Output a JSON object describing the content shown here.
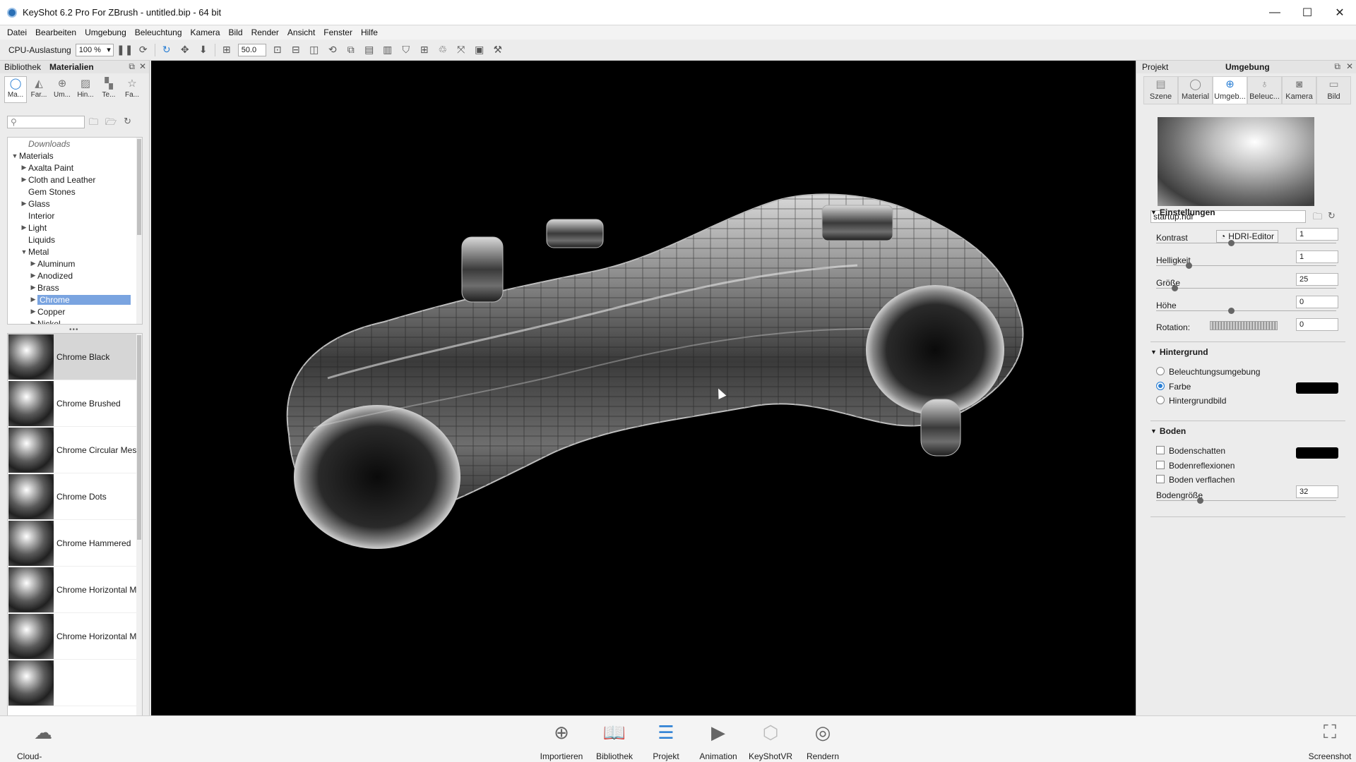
{
  "window": {
    "title": "KeyShot 6.2 Pro For ZBrush - untitled.bip  - 64 bit",
    "minimize": "—",
    "maximize": "☐",
    "close": "✕"
  },
  "menu": [
    "Datei",
    "Bearbeiten",
    "Umgebung",
    "Beleuchtung",
    "Kamera",
    "Bild",
    "Render",
    "Ansicht",
    "Fenster",
    "Hilfe"
  ],
  "toolbar": {
    "cpu_label": "CPU-Auslastung",
    "cpu_value": "100 %",
    "focal_value": "50.0"
  },
  "left_panel": {
    "tabs_header": [
      "Bibliothek",
      "Materialien"
    ],
    "tabs": [
      "Ma...",
      "Far...",
      "Um...",
      "Hin...",
      "Te...",
      "Fa..."
    ],
    "search_placeholder": "",
    "tree": [
      {
        "label": "Downloads",
        "level": 1,
        "arrow": "",
        "italic": true
      },
      {
        "label": "Materials",
        "level": 0,
        "arrow": "▼"
      },
      {
        "label": "Axalta Paint",
        "level": 1,
        "arrow": "▶"
      },
      {
        "label": "Cloth and Leather",
        "level": 1,
        "arrow": "▶"
      },
      {
        "label": "Gem Stones",
        "level": 1,
        "arrow": ""
      },
      {
        "label": "Glass",
        "level": 1,
        "arrow": "▶"
      },
      {
        "label": "Interior",
        "level": 1,
        "arrow": ""
      },
      {
        "label": "Light",
        "level": 1,
        "arrow": "▶"
      },
      {
        "label": "Liquids",
        "level": 1,
        "arrow": ""
      },
      {
        "label": "Metal",
        "level": 1,
        "arrow": "▼"
      },
      {
        "label": "Aluminum",
        "level": 2,
        "arrow": "▶"
      },
      {
        "label": "Anodized",
        "level": 2,
        "arrow": "▶"
      },
      {
        "label": "Brass",
        "level": 2,
        "arrow": "▶"
      },
      {
        "label": "Chrome",
        "level": 2,
        "arrow": "▶",
        "selected": true
      },
      {
        "label": "Copper",
        "level": 2,
        "arrow": "▶"
      },
      {
        "label": "Nickel",
        "level": 2,
        "arrow": "▶"
      }
    ],
    "materials": [
      {
        "name": "Chrome Black",
        "selected": true
      },
      {
        "name": "Chrome Brushed"
      },
      {
        "name": "Chrome Circular Mesh"
      },
      {
        "name": "Chrome Dots"
      },
      {
        "name": "Chrome Hammered"
      },
      {
        "name": "Chrome Horizontal Me"
      },
      {
        "name": "Chrome Horizontal Me"
      },
      {
        "name": ""
      }
    ]
  },
  "right_panel": {
    "header_left": "Projekt",
    "header_center": "Umgebung",
    "tabs": [
      "Szene",
      "Material",
      "Umgeb...",
      "Beleuc...",
      "Kamera",
      "Bild"
    ],
    "hdr_file": "startup.hdr",
    "hdri_editor_label": "HDRI-Editor",
    "settings": {
      "title": "Einstellungen",
      "kontrast_label": "Kontrast",
      "kontrast": "1",
      "helligkeit_label": "Helligkeit",
      "helligkeit": "1",
      "groesse_label": "Größe",
      "groesse": "25",
      "hoehe_label": "Höhe",
      "hoehe": "0",
      "rotation_label": "Rotation:",
      "rotation": "0"
    },
    "background": {
      "title": "Hintergrund",
      "options": [
        "Beleuchtungsumgebung",
        "Farbe",
        "Hintergrundbild"
      ],
      "selected": 1,
      "color": "#000000"
    },
    "floor": {
      "title": "Boden",
      "shadow_label": "Bodenschatten",
      "reflections_label": "Bodenreflexionen",
      "flatten_label": "Boden verflachen",
      "size_label": "Bodengröße",
      "size": "32"
    }
  },
  "bottom": {
    "cloud_label": "Cloud-Bibliothek",
    "items": [
      "Importieren",
      "Bibliothek",
      "Projekt",
      "Animation",
      "KeyShotVR",
      "Rendern"
    ],
    "screenshot_label": "Screenshot"
  }
}
